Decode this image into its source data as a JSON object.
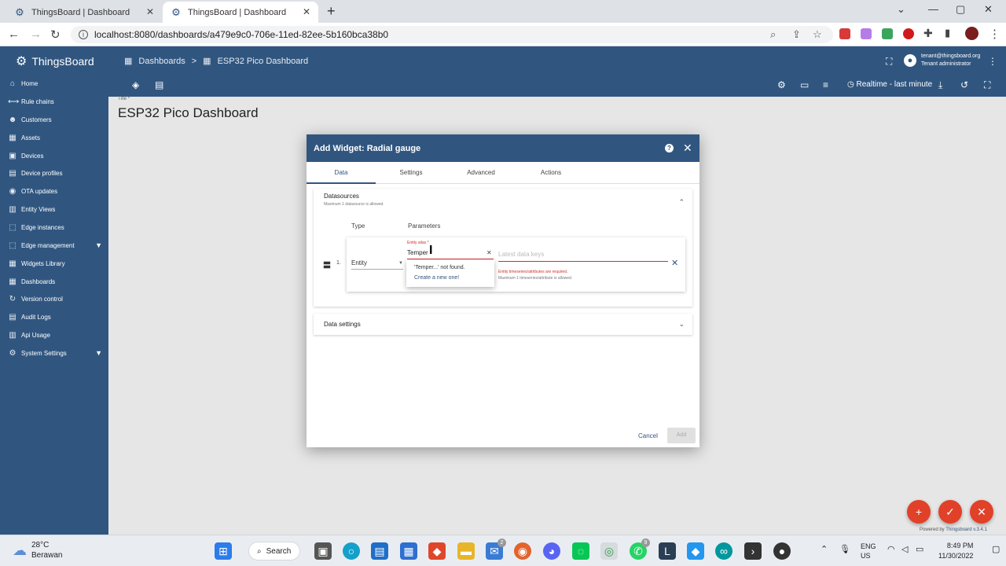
{
  "browser": {
    "tabs": [
      {
        "title": "ThingsBoard | Dashboard",
        "active": false
      },
      {
        "title": "ThingsBoard | Dashboard",
        "active": true
      }
    ],
    "url": "localhost:8080/dashboards/a479e9c0-706e-11ed-82ee-5b160bca38b0"
  },
  "app": {
    "logo": "ThingsBoard",
    "breadcrumbs": [
      "Dashboards",
      "ESP32 Pico Dashboard"
    ],
    "user_email": "tenant@thingsboard.org",
    "user_role": "Tenant administrator",
    "realtime_label": "Realtime - last minute",
    "accent_color": "#305680"
  },
  "sidebar": {
    "items": [
      {
        "label": "Home",
        "icon": "home-icon"
      },
      {
        "label": "Rule chains",
        "icon": "rule-chain-icon"
      },
      {
        "label": "Customers",
        "icon": "customers-icon"
      },
      {
        "label": "Assets",
        "icon": "assets-icon"
      },
      {
        "label": "Devices",
        "icon": "devices-icon"
      },
      {
        "label": "Device profiles",
        "icon": "device-profile-icon"
      },
      {
        "label": "OTA updates",
        "icon": "ota-icon"
      },
      {
        "label": "Entity Views",
        "icon": "entity-views-icon"
      },
      {
        "label": "Edge instances",
        "icon": "edge-icon"
      },
      {
        "label": "Edge management",
        "icon": "edge-management-icon",
        "expandable": true
      },
      {
        "label": "Widgets Library",
        "icon": "widgets-icon"
      },
      {
        "label": "Dashboards",
        "icon": "dashboards-icon"
      },
      {
        "label": "Version control",
        "icon": "version-control-icon"
      },
      {
        "label": "Audit Logs",
        "icon": "audit-icon"
      },
      {
        "label": "Api Usage",
        "icon": "api-usage-icon"
      },
      {
        "label": "System Settings",
        "icon": "settings-icon",
        "expandable": true
      }
    ]
  },
  "main": {
    "title_label": "Title *",
    "title": "ESP32 Pico Dashboard"
  },
  "dialog": {
    "title": "Add Widget: Radial gauge",
    "tabs": [
      "Data",
      "Settings",
      "Advanced",
      "Actions"
    ],
    "active_tab": "Data",
    "datasources": {
      "title": "Datasources",
      "subtitle": "Maximum 1 datasource is allowed.",
      "col_type": "Type",
      "col_params": "Parameters",
      "row_number": "1.",
      "type_value": "Entity",
      "alias_label": "Entity alias *",
      "alias_value": "Temper",
      "keys_placeholder": "Latest data keys",
      "keys_error": "Entity timeseries/attributes are required.",
      "keys_hint": "Maximum 1 timeseries/attribute is allowed.",
      "dropdown_not_found": "'Temper...' not found.",
      "dropdown_create": "Create a new one!"
    },
    "data_settings_title": "Data settings",
    "cancel_label": "Cancel",
    "add_label": "Add"
  },
  "footer": {
    "powered_prefix": "Powered by",
    "powered_name": "Thingsboard v.3.4.1"
  },
  "taskbar": {
    "temperature": "28°C",
    "location": "Berawan",
    "search_label": "Search",
    "lang_line1": "ENG",
    "lang_line2": "US",
    "time": "8:49 PM",
    "date": "11/30/2022",
    "badge_1": "2",
    "badge_2": "9"
  }
}
